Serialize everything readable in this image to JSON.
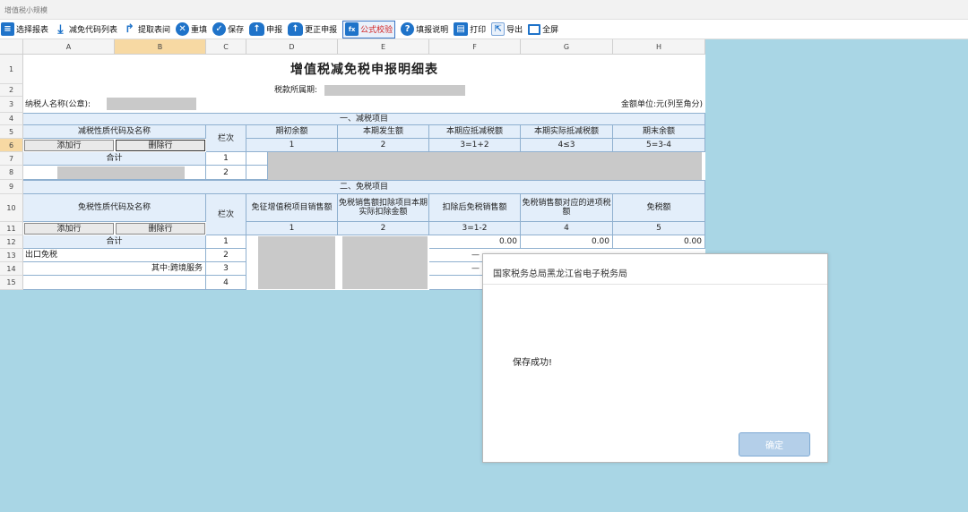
{
  "window": {
    "title": "增值税小规模"
  },
  "toolbar": [
    {
      "label": "选择报表",
      "icon": "list-icon"
    },
    {
      "label": "减免代码列表",
      "icon": "download-icon"
    },
    {
      "label": "提取表间",
      "icon": "share-arrow-icon"
    },
    {
      "label": "重填",
      "icon": "close-circle-icon"
    },
    {
      "label": "保存",
      "icon": "check-circle-icon"
    },
    {
      "label": "申报",
      "icon": "cloud-upload-icon"
    },
    {
      "label": "更正申报",
      "icon": "cloud-upload-icon"
    },
    {
      "label": "公式校验",
      "icon": "formula-icon"
    },
    {
      "label": "填报说明",
      "icon": "help-icon"
    },
    {
      "label": "打印",
      "icon": "printer-icon"
    },
    {
      "label": "导出",
      "icon": "export-icon"
    },
    {
      "label": "全屏",
      "icon": "fullscreen-icon"
    }
  ],
  "columns": [
    "A",
    "B",
    "C",
    "D",
    "E",
    "F",
    "G",
    "H"
  ],
  "rows": [
    "1",
    "2",
    "3",
    "4",
    "5",
    "6",
    "7",
    "8",
    "9",
    "10",
    "11",
    "12",
    "13",
    "14",
    "15"
  ],
  "form": {
    "title": "增值税减免税申报明细表",
    "period_label": "税款所属期:",
    "taxpayer_label": "纳税人名称(公章):",
    "unit_label": "金额单位:元(列至角分)",
    "sec1": "一、减税项目",
    "sec1_col_name": "减税性质代码及名称",
    "lanci": "栏次",
    "sec1_cols": [
      "期初余额",
      "本期发生额",
      "本期应抵减税额",
      "本期实际抵减税额",
      "期末余额"
    ],
    "sec1_nums": [
      "1",
      "2",
      "3=1+2",
      "4≤3",
      "5=3-4"
    ],
    "add_row": "添加行",
    "del_row": "删除行",
    "total": "合计",
    "line1": "1",
    "line2": "2",
    "line3": "3",
    "line4": "4",
    "sec2": "二、免税项目",
    "sec2_col_name": "免税性质代码及名称",
    "sec2_cols": [
      "免征增值税项目销售额",
      "免税销售额扣除项目本期实际扣除金额",
      "扣除后免税销售额",
      "免税销售额对应的进项税额",
      "免税额"
    ],
    "sec2_nums": [
      "1",
      "2",
      "3=1-2",
      "4",
      "5"
    ],
    "total_vals": [
      "0.00",
      "0.00",
      "0.00"
    ],
    "export": "出口免税",
    "cross": "其中:跨境服务",
    "dash": "—"
  },
  "dialog": {
    "title": "国家税务总局黑龙江省电子税务局",
    "message": "保存成功!",
    "ok": "确定"
  }
}
